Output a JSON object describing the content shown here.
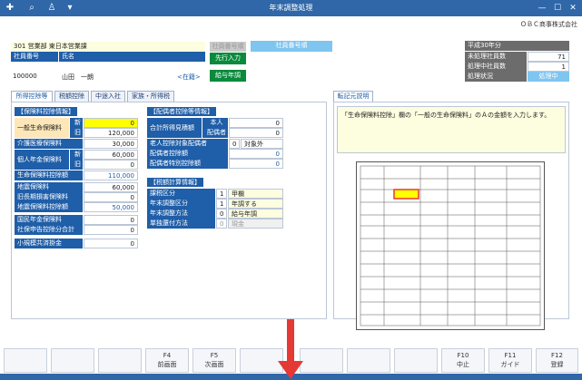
{
  "window": {
    "title": "年末調整処理",
    "company": "ＯＢＣ商事株式会社"
  },
  "header": {
    "dept": "301 営業部 東日本営業課",
    "emp_code_label": "社員番号",
    "emp_name_label": "氏名",
    "emp_code": "100000",
    "emp_name": "山田　一朗",
    "status_link": "<在籍>",
    "btn_gray": "社員番号順",
    "btn_order": "社員番号順",
    "btn_first": "先行入力",
    "btn_salary": "給与年調"
  },
  "summary": {
    "year": "平成30年分",
    "rows": [
      {
        "label": "未処理社員数",
        "value": "71"
      },
      {
        "label": "処理中社員数",
        "value": "1"
      },
      {
        "label": "処理状況",
        "value": "処理中"
      }
    ]
  },
  "tabs": [
    "所得控除等",
    "税額控除",
    "中途入社",
    "家族・所得税"
  ],
  "hint_tab": "転記元説明",
  "hint_text": "「生命保険料控除」欄の「一般の生命保険料」のＡの金額を入力します。",
  "insurance": {
    "title": "【保険料控除情報】",
    "general_life": "一般生命保険料",
    "new": "新",
    "old": "旧",
    "general_new": "0",
    "general_old": "120,000",
    "care": "介護医療保険料",
    "care_val": "30,000",
    "pension": "個人年金保険料",
    "pension_new": "60,000",
    "pension_old": "0",
    "life_deduct": "生命保険料控除額",
    "life_deduct_val": "110,000",
    "quake": "地震保険料",
    "quake_val": "60,000",
    "longterm": "旧長期損害保険料",
    "longterm_val": "0",
    "quake_deduct": "地震保険料控除額",
    "quake_deduct_val": "50,000",
    "national_pension": "国民年金保険料",
    "national_pension_val": "0",
    "social_total": "社保申告控除分合計",
    "social_total_val": "0",
    "small_biz": "小規模共済掛金",
    "small_biz_val": "0"
  },
  "spouse": {
    "title": "【配偶者控除等情報】",
    "est_income": "合計所得見積額",
    "self": "本人",
    "spouse": "配偶者",
    "self_val": "0",
    "spouse_val": "0",
    "elderly": "老人控除対象配偶者",
    "elderly_val": "0",
    "elderly_flag": "対象外",
    "deduct": "配偶者控除額",
    "deduct_val": "0",
    "special": "配偶者特別控除額",
    "special_val": "0"
  },
  "tax": {
    "title": "【税額計算情報】",
    "rows": [
      {
        "label": "課税区分",
        "code": "1",
        "value": "甲欄"
      },
      {
        "label": "年末調整区分",
        "code": "1",
        "value": "年調する"
      },
      {
        "label": "年末調整方法",
        "code": "0",
        "value": "給与年調"
      },
      {
        "label": "単独還付方法",
        "code": "0",
        "value": "現金"
      }
    ]
  },
  "fkeys": [
    {
      "key": "",
      "name": ""
    },
    {
      "key": "",
      "name": ""
    },
    {
      "key": "",
      "name": ""
    },
    {
      "key": "F4",
      "name": "前画面"
    },
    {
      "key": "F5",
      "name": "次画面"
    },
    {
      "key": "",
      "name": ""
    },
    {
      "key": "",
      "name": ""
    },
    {
      "key": "",
      "name": ""
    },
    {
      "key": "",
      "name": ""
    },
    {
      "key": "F10",
      "name": "中止"
    },
    {
      "key": "F11",
      "name": "ガイド"
    },
    {
      "key": "F12",
      "name": "登録"
    }
  ],
  "colors": {
    "accent": "#1f5ea8",
    "titlebar": "#2f67a8",
    "green": "#0a8a3c",
    "yellow": "#ffff00",
    "arrow": "#e53935"
  }
}
